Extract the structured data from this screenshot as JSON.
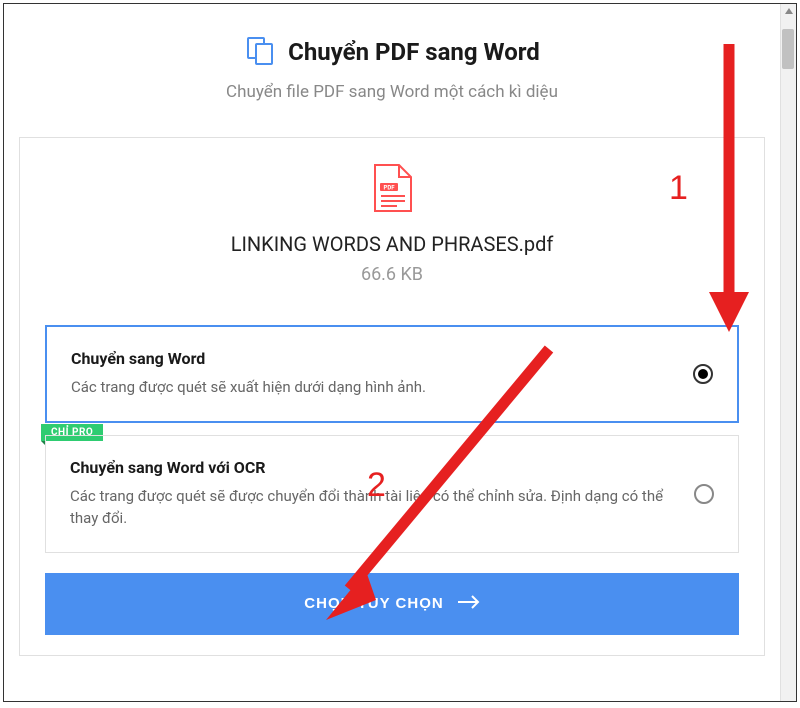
{
  "header": {
    "title": "Chuyển PDF sang Word",
    "subtitle": "Chuyển file PDF sang Word một cách kì diệu"
  },
  "file": {
    "name": "LINKING WORDS AND PHRASES.pdf",
    "size": "66.6 KB",
    "badge": "PDF"
  },
  "options": [
    {
      "title": "Chuyển sang Word",
      "desc": "Các trang được quét sẽ xuất hiện dưới dạng hình ảnh.",
      "selected": true
    },
    {
      "title": "Chuyển sang Word với OCR",
      "desc": "Các trang được quét sẽ được chuyển đổi thành tài liệu có thể chỉnh sửa. Định dạng có thể thay đổi.",
      "selected": false,
      "pro_badge": "CHỈ PRO"
    }
  ],
  "cta": {
    "label": "CHỌN TÙY CHỌN"
  },
  "annotations": {
    "label1": "1",
    "label2": "2"
  },
  "colors": {
    "accent": "#4a8ff0",
    "annotation": "#e62020",
    "pro": "#2ecc71"
  }
}
